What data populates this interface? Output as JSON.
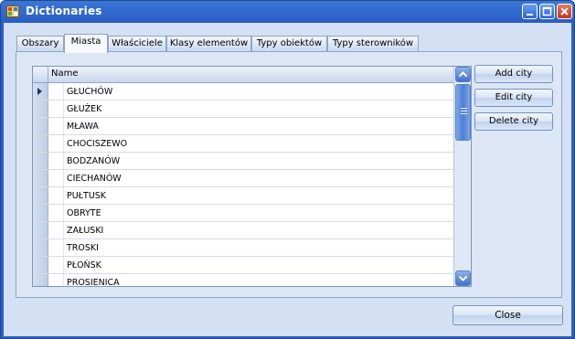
{
  "window": {
    "title": "Dictionaries"
  },
  "tabs": [
    "Obszary",
    "Miasta",
    "Właściciele",
    "Klasy elementów",
    "Typy obiektów",
    "Typy sterowników"
  ],
  "active_tab": "Miasta",
  "grid": {
    "column_header": "Name",
    "rows": [
      "GŁUCHÓW",
      "GŁUŻEK",
      "MŁAWA",
      "CHOCISZEWO",
      "BODZANÓW",
      "CIECHANÓW",
      "PUŁTUSK",
      "OBRYTE",
      "ZAŁUSKI",
      "TROSKI",
      "PŁOŃSK",
      "PROSIENICA"
    ],
    "selected_row": 0
  },
  "actions": {
    "add": "Add city",
    "edit": "Edit city",
    "delete": "Delete city"
  },
  "footer": {
    "close": "Close"
  },
  "colors": {
    "titlebar": "#2a5fc5",
    "client": "#d4e0f3",
    "panel": "#dce6f5"
  }
}
